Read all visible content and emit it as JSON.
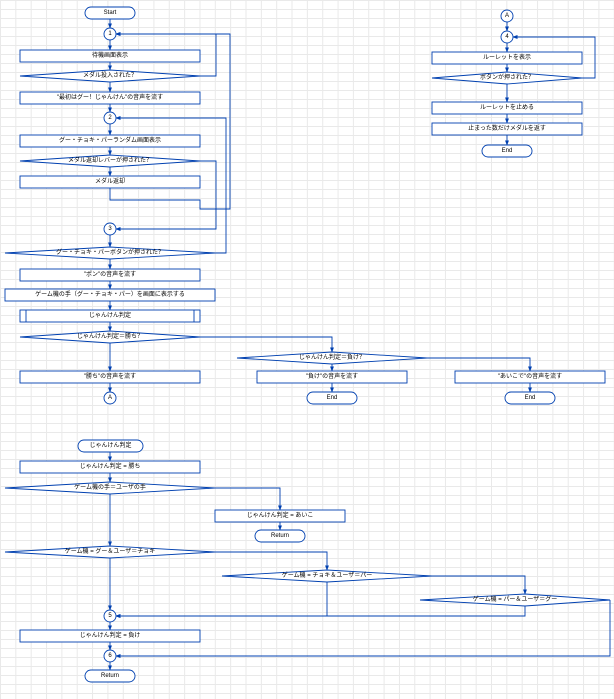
{
  "main": {
    "start": "Start",
    "n1": "1",
    "step_standby": "待機画面表示",
    "dec_medal": "メダル投入された？",
    "step_voice_first": "\"最初はグー！じゃんけん\"の音声を流す",
    "n2": "2",
    "step_random_disp": "グー・チョキ・パーランダム画面表示",
    "dec_return_lever": "メダル返却レバーが押された？",
    "step_return": "メダル返却",
    "n3": "3",
    "dec_button": "グー・チョキ・パーボタンが押された？",
    "step_pon": "\"ポン\"の音声を流す",
    "step_show_hand": "ゲーム機の手（グー・チョキ・パー）を画面に表示する",
    "sub_judge": "じゃんけん判定",
    "dec_win": "じゃんけん判定＝勝ち？",
    "dec_lose": "じゃんけん判定＝負け？",
    "step_win_voice": "\"勝ち\"の音声を流す",
    "step_lose_voice": "\"負け\"の音声を流す",
    "step_aiko_voice": "\"あいこで\"の音声を流す",
    "nA_left": "A",
    "end_lose": "End",
    "end_aiko": "End"
  },
  "right": {
    "nA": "A",
    "n4": "4",
    "step_roulette": "ルーレットを表示",
    "dec_button": "ボタンが押された？",
    "step_stop": "ルーレットを止める",
    "step_pay": "止まった数だけメダルを返す",
    "end": "End"
  },
  "sub": {
    "name": "じゃんけん判定",
    "step_win": "じゃんけん判定 = 勝ち",
    "dec_same": "ゲーム機の手＝ユーザの手",
    "step_aiko": "じゃんけん判定 = あいこ",
    "ret1": "Return",
    "dec_gu": "ゲーム機 = グー＆ユーザ＝チョキ",
    "dec_choki": "ゲーム機 = チョキ＆ユーザ＝パー",
    "dec_pa": "ゲーム機 = パー＆ユーザ＝グー",
    "n5": "5",
    "step_lose": "じゃんけん判定 = 負け",
    "n6": "6",
    "ret2": "Return"
  }
}
